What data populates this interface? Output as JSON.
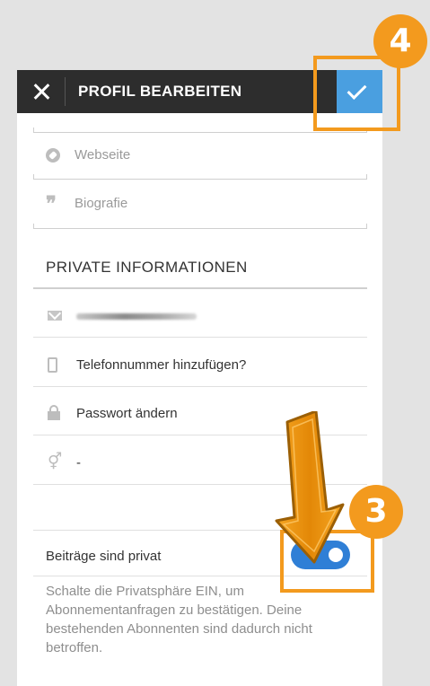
{
  "header": {
    "title": "PROFIL BEARBEITEN",
    "close_icon": "close-icon",
    "confirm_icon": "check-icon"
  },
  "fields": {
    "website_placeholder": "Webseite",
    "bio_placeholder": "Biografie"
  },
  "private_section": {
    "title": "PRIVATE INFORMATIONEN",
    "phone_label": "Telefonnummer hinzufügen?",
    "password_label": "Passwort ändern",
    "gender_value": "-"
  },
  "privacy": {
    "label": "Beiträge sind privat",
    "toggle_on": true,
    "description": "Schalte die Privatsphäre EIN, um Abonnementanfragen zu bestätigen. Deine bestehenden Abonnenten sind dadurch nicht betroffen."
  },
  "annotations": {
    "step_confirm": "4",
    "step_toggle": "3",
    "accent_color": "#f39a1e"
  }
}
